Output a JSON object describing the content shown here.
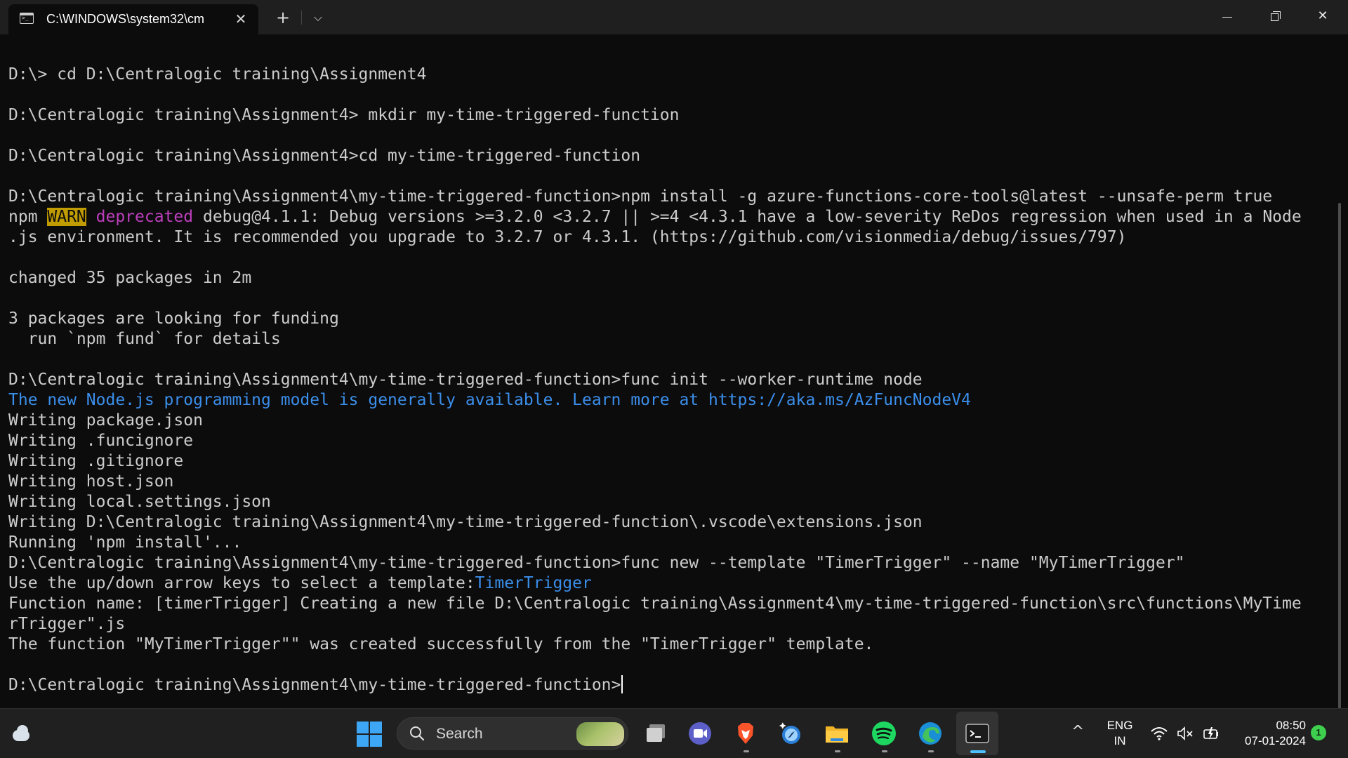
{
  "window": {
    "tab_title": "C:\\WINDOWS\\system32\\cm",
    "tab_close_glyph": "✕",
    "new_tab_glyph": "+",
    "dropdown_glyph": "⌵",
    "close_glyph": "✕"
  },
  "terminal": {
    "lines": [
      {
        "text": "D:\\> cd D:\\Centralogic training\\Assignment4"
      },
      {
        "text": ""
      },
      {
        "text": "D:\\Centralogic training\\Assignment4> mkdir my-time-triggered-function"
      },
      {
        "text": ""
      },
      {
        "text": "D:\\Centralogic training\\Assignment4>cd my-time-triggered-function"
      },
      {
        "text": ""
      },
      {
        "text": "D:\\Centralogic training\\Assignment4\\my-time-triggered-function>npm install -g azure-functions-core-tools@latest --unsafe-perm true"
      },
      {
        "segments": [
          {
            "text": "npm ",
            "style": "normal"
          },
          {
            "text": "WARN",
            "style": "warn"
          },
          {
            "text": " ",
            "style": "normal"
          },
          {
            "text": "deprecated",
            "style": "magenta"
          },
          {
            "text": " debug@4.1.1: Debug versions >=3.2.0 <3.2.7 || >=4 <4.3.1 have a low-severity ReDos regression when used in a Node",
            "style": "normal"
          }
        ]
      },
      {
        "text": ".js environment. It is recommended you upgrade to 3.2.7 or 4.3.1. (https://github.com/visionmedia/debug/issues/797)"
      },
      {
        "text": ""
      },
      {
        "text": "changed 35 packages in 2m"
      },
      {
        "text": ""
      },
      {
        "text": "3 packages are looking for funding"
      },
      {
        "text": "  run `npm fund` for details"
      },
      {
        "text": ""
      },
      {
        "text": "D:\\Centralogic training\\Assignment4\\my-time-triggered-function>func init --worker-runtime node"
      },
      {
        "text": "The new Node.js programming model is generally available. Learn more at https://aka.ms/AzFuncNodeV4",
        "style": "blue"
      },
      {
        "text": "Writing package.json"
      },
      {
        "text": "Writing .funcignore"
      },
      {
        "text": "Writing .gitignore"
      },
      {
        "text": "Writing host.json"
      },
      {
        "text": "Writing local.settings.json"
      },
      {
        "text": "Writing D:\\Centralogic training\\Assignment4\\my-time-triggered-function\\.vscode\\extensions.json"
      },
      {
        "text": "Running 'npm install'..."
      },
      {
        "text": "D:\\Centralogic training\\Assignment4\\my-time-triggered-function>func new --template \"TimerTrigger\" --name \"MyTimerTrigger\""
      },
      {
        "segments": [
          {
            "text": "Use the up/down arrow keys to select a template:",
            "style": "normal"
          },
          {
            "text": "TimerTrigger",
            "style": "blue"
          }
        ]
      },
      {
        "text": "Function name: [timerTrigger] Creating a new file D:\\Centralogic training\\Assignment4\\my-time-triggered-function\\src\\functions\\MyTime"
      },
      {
        "text": "rTrigger\".js"
      },
      {
        "text": "The function \"MyTimerTrigger\"\" was created successfully from the \"TimerTrigger\" template."
      },
      {
        "text": ""
      },
      {
        "text": "D:\\Centralogic training\\Assignment4\\my-time-triggered-function>",
        "cursor": true
      }
    ]
  },
  "taskbar": {
    "search_label": "Search",
    "language": "ENG",
    "region": "IN",
    "time": "08:50",
    "date": "07-01-2024",
    "notification_count": "1",
    "tray_chevron": "^"
  },
  "colors": {
    "console_bg": "#0c0c0c",
    "console_fg": "#cccccc",
    "link_blue": "#3b8eea",
    "warn_bg": "#c19c00",
    "deprecated_magenta": "#bc3fbc"
  }
}
